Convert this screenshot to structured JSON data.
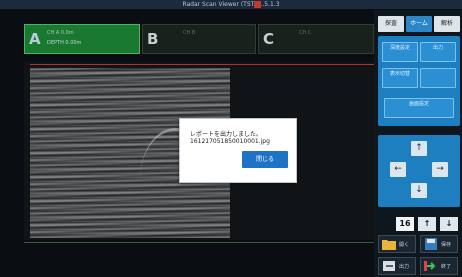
{
  "window": {
    "title": "Radar Scan Viewer (TST) 1.5.1.3"
  },
  "channels": [
    {
      "letter": "A",
      "line1": "CH A 0.0m",
      "line2": "DEPTH 0.00m"
    },
    {
      "letter": "B",
      "line1": "CH B",
      "line2": ""
    },
    {
      "letter": "C",
      "line1": "CH C",
      "line2": ""
    }
  ],
  "right_panel": {
    "tabs": [
      "探査",
      "ホーム",
      "解析"
    ],
    "buttons_row1": [
      "深度設定",
      "出力",
      "表示切替"
    ],
    "wide_button": "画面設定",
    "count": "16",
    "count_up": "↑",
    "count_down": "↓",
    "icon_buttons": [
      {
        "icon": "folder-icon",
        "label": "開く"
      },
      {
        "icon": "save-icon",
        "label": "保存"
      },
      {
        "icon": "export-icon",
        "label": "出力"
      },
      {
        "icon": "exit-icon",
        "label": "終了"
      }
    ]
  },
  "arrows": {
    "up": "↑",
    "down": "↓",
    "left": "←",
    "right": "→"
  },
  "dialog": {
    "line1": "レポートを出力しました。",
    "line2": "161217051850010001.jpg",
    "ok_label": "閉じる"
  },
  "colors": {
    "accent": "#1e73c6",
    "channel_active": "#1f8f3a",
    "panel": "#1d7fc0"
  }
}
